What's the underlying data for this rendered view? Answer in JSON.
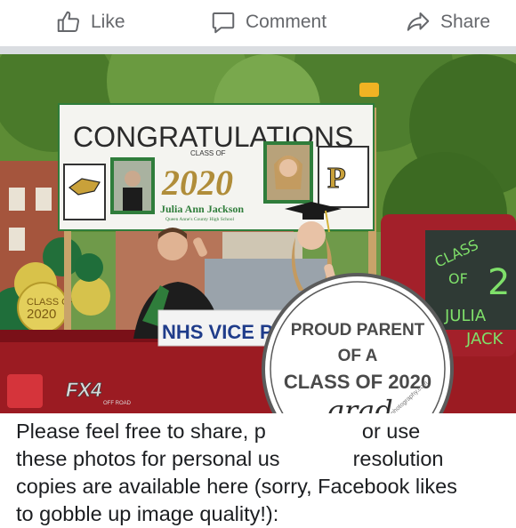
{
  "actions": {
    "like_label": "Like",
    "comment_label": "Comment",
    "share_label": "Share"
  },
  "photo": {
    "banner_title": "CONGRATULATIONS",
    "banner_class_of": "CLASS OF",
    "banner_year": "2020",
    "banner_name": "Julia Ann Jackson",
    "banner_school": "Queen Anne's County High School",
    "right_logo": "P",
    "sign_text": "NHS VICE PRE",
    "truck_badge": "FX4",
    "truck_badge_sub": "OFF ROAD",
    "balloon_text_1": "CLASS OF",
    "balloon_text_2": "2020",
    "window_text_1": "CLASS",
    "window_text_2": "OF",
    "window_text_3": "2",
    "window_text_4": "JULIA",
    "window_text_5": "JACK",
    "stamp_line1": "PROUD PARENT",
    "stamp_line2": "OF A",
    "stamp_line3": "CLASS OF 2020",
    "stamp_script": "grad",
    "watermark": "fabiolaphotography.com",
    "colors": {
      "banner_green": "#2f7d3b",
      "banner_gold": "#b08d3a",
      "truck_red": "#9b1b22",
      "foliage": "#4d7a2c"
    }
  },
  "caption": {
    "line1_a": "Please feel free to share, p",
    "line1_b": "or use",
    "line2_a": "these photos for personal us",
    "line2_b": "resolution",
    "line3": "copies are available here (sorry, Facebook likes",
    "line4": "to gobble up image quality!):"
  }
}
